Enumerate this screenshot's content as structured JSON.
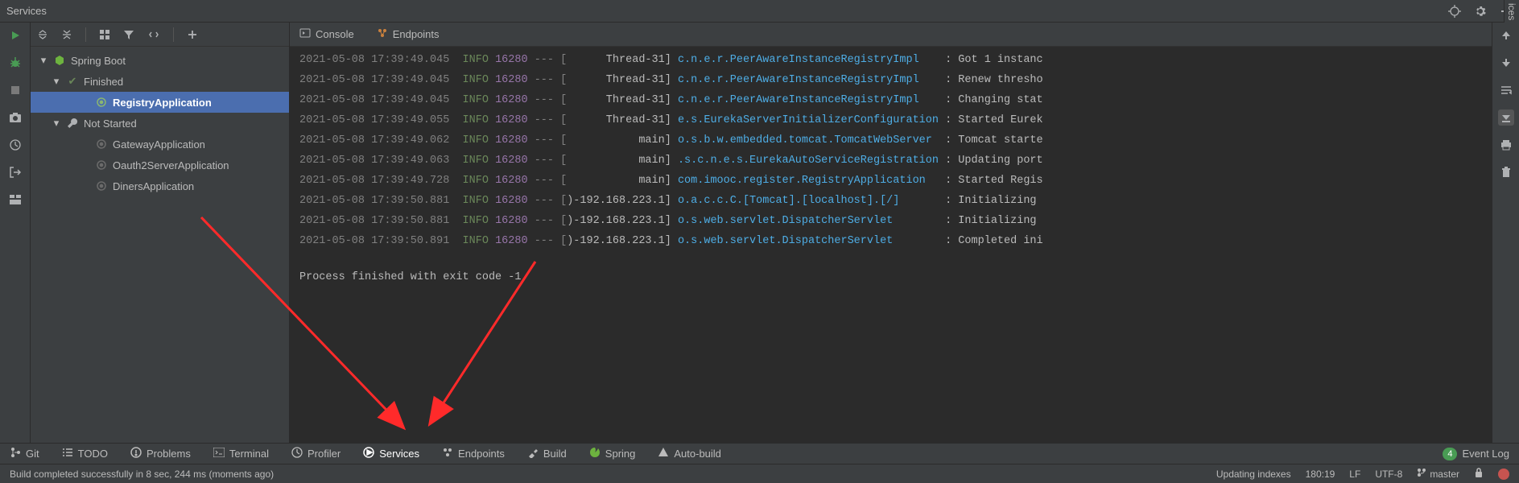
{
  "panel": {
    "title": "Services"
  },
  "side_tab": {
    "label": "ices"
  },
  "tree": {
    "root": {
      "label": "Spring Boot"
    },
    "finished_group": {
      "label": "Finished"
    },
    "finished_items": [
      {
        "label": "RegistryApplication"
      }
    ],
    "not_started_group": {
      "label": "Not Started"
    },
    "not_started_items": [
      {
        "label": "GatewayApplication"
      },
      {
        "label": "Oauth2ServerApplication"
      },
      {
        "label": "DinersApplication"
      }
    ]
  },
  "console_tabs": {
    "console": "Console",
    "endpoints": "Endpoints"
  },
  "log": [
    {
      "ts": "2021-05-08 17:39:49.045",
      "lvl": "INFO",
      "pid": "16280",
      "thr": "      Thread-31]",
      "cls": "c.n.e.r.PeerAwareInstanceRegistryImpl   ",
      "msg": ": Got 1 instanc"
    },
    {
      "ts": "2021-05-08 17:39:49.045",
      "lvl": "INFO",
      "pid": "16280",
      "thr": "      Thread-31]",
      "cls": "c.n.e.r.PeerAwareInstanceRegistryImpl   ",
      "msg": ": Renew thresho"
    },
    {
      "ts": "2021-05-08 17:39:49.045",
      "lvl": "INFO",
      "pid": "16280",
      "thr": "      Thread-31]",
      "cls": "c.n.e.r.PeerAwareInstanceRegistryImpl   ",
      "msg": ": Changing stat"
    },
    {
      "ts": "2021-05-08 17:39:49.055",
      "lvl": "INFO",
      "pid": "16280",
      "thr": "      Thread-31]",
      "cls": "e.s.EurekaServerInitializerConfiguration",
      "msg": ": Started Eurek"
    },
    {
      "ts": "2021-05-08 17:39:49.062",
      "lvl": "INFO",
      "pid": "16280",
      "thr": "           main]",
      "cls": "o.s.b.w.embedded.tomcat.TomcatWebServer ",
      "msg": ": Tomcat starte"
    },
    {
      "ts": "2021-05-08 17:39:49.063",
      "lvl": "INFO",
      "pid": "16280",
      "thr": "           main]",
      "cls": ".s.c.n.e.s.EurekaAutoServiceRegistration",
      "msg": ": Updating port"
    },
    {
      "ts": "2021-05-08 17:39:49.728",
      "lvl": "INFO",
      "pid": "16280",
      "thr": "           main]",
      "cls": "com.imooc.register.RegistryApplication  ",
      "msg": ": Started Regis"
    },
    {
      "ts": "2021-05-08 17:39:50.881",
      "lvl": "INFO",
      "pid": "16280",
      "thr": ")-192.168.223.1]",
      "cls": "o.a.c.c.C.[Tomcat].[localhost].[/]      ",
      "msg": ": Initializing "
    },
    {
      "ts": "2021-05-08 17:39:50.881",
      "lvl": "INFO",
      "pid": "16280",
      "thr": ")-192.168.223.1]",
      "cls": "o.s.web.servlet.DispatcherServlet       ",
      "msg": ": Initializing "
    },
    {
      "ts": "2021-05-08 17:39:50.891",
      "lvl": "INFO",
      "pid": "16280",
      "thr": ")-192.168.223.1]",
      "cls": "o.s.web.servlet.DispatcherServlet       ",
      "msg": ": Completed ini"
    }
  ],
  "exit_message": "Process finished with exit code -1",
  "bottom_tools": {
    "git": "Git",
    "todo": "TODO",
    "problems": "Problems",
    "terminal": "Terminal",
    "profiler": "Profiler",
    "services": "Services",
    "endpoints": "Endpoints",
    "build": "Build",
    "spring": "Spring",
    "autobuild": "Auto-build",
    "eventlog_count": "4",
    "eventlog": "Event Log"
  },
  "status": {
    "build_msg": "Build completed successfully in 8 sec, 244 ms (moments ago)",
    "updating": "Updating indexes",
    "pos": "180:19",
    "le": "LF",
    "enc": "UTF-8",
    "branch": "master"
  }
}
